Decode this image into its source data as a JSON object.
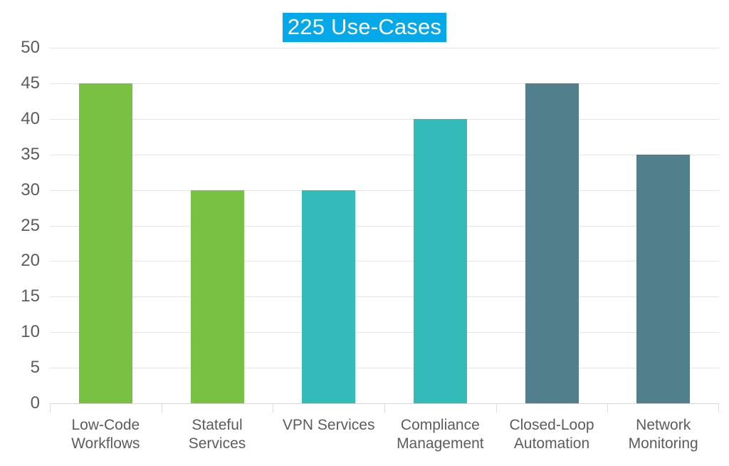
{
  "chart_data": {
    "type": "bar",
    "title": "225 Use-Cases",
    "xlabel": "",
    "ylabel": "",
    "ylim": [
      0,
      50
    ],
    "ytick_step": 5,
    "yticks": [
      50,
      45,
      40,
      35,
      30,
      25,
      20,
      15,
      10,
      5,
      0
    ],
    "grid": true,
    "legend": "none",
    "categories": [
      "Low-Code Workflows",
      "Stateful Services",
      "VPN Services",
      "Compliance Management",
      "Closed-Loop Automation",
      "Network Monitoring"
    ],
    "category_lines": [
      [
        "Low-Code",
        "Workflows"
      ],
      [
        "Stateful",
        "Services"
      ],
      [
        "VPN Services"
      ],
      [
        "Compliance",
        "Management"
      ],
      [
        "Closed-Loop",
        "Automation"
      ],
      [
        "Network",
        "Monitoring"
      ]
    ],
    "values": [
      45,
      30,
      30,
      40,
      45,
      35
    ],
    "bar_colors": [
      "#79C143",
      "#79C143",
      "#33BBBA",
      "#33BBBA",
      "#517F8B",
      "#517F8B"
    ]
  },
  "style": {
    "title_highlight_color": "#05A8E8",
    "title_text_color": "#FFFFFF",
    "axis_label_color": "#5C5C5C",
    "gridline_color": "#E4E4E4",
    "background_color": "#FFFFFF",
    "green": "#79C143",
    "teal": "#33BBBA",
    "slate": "#517F8B"
  }
}
